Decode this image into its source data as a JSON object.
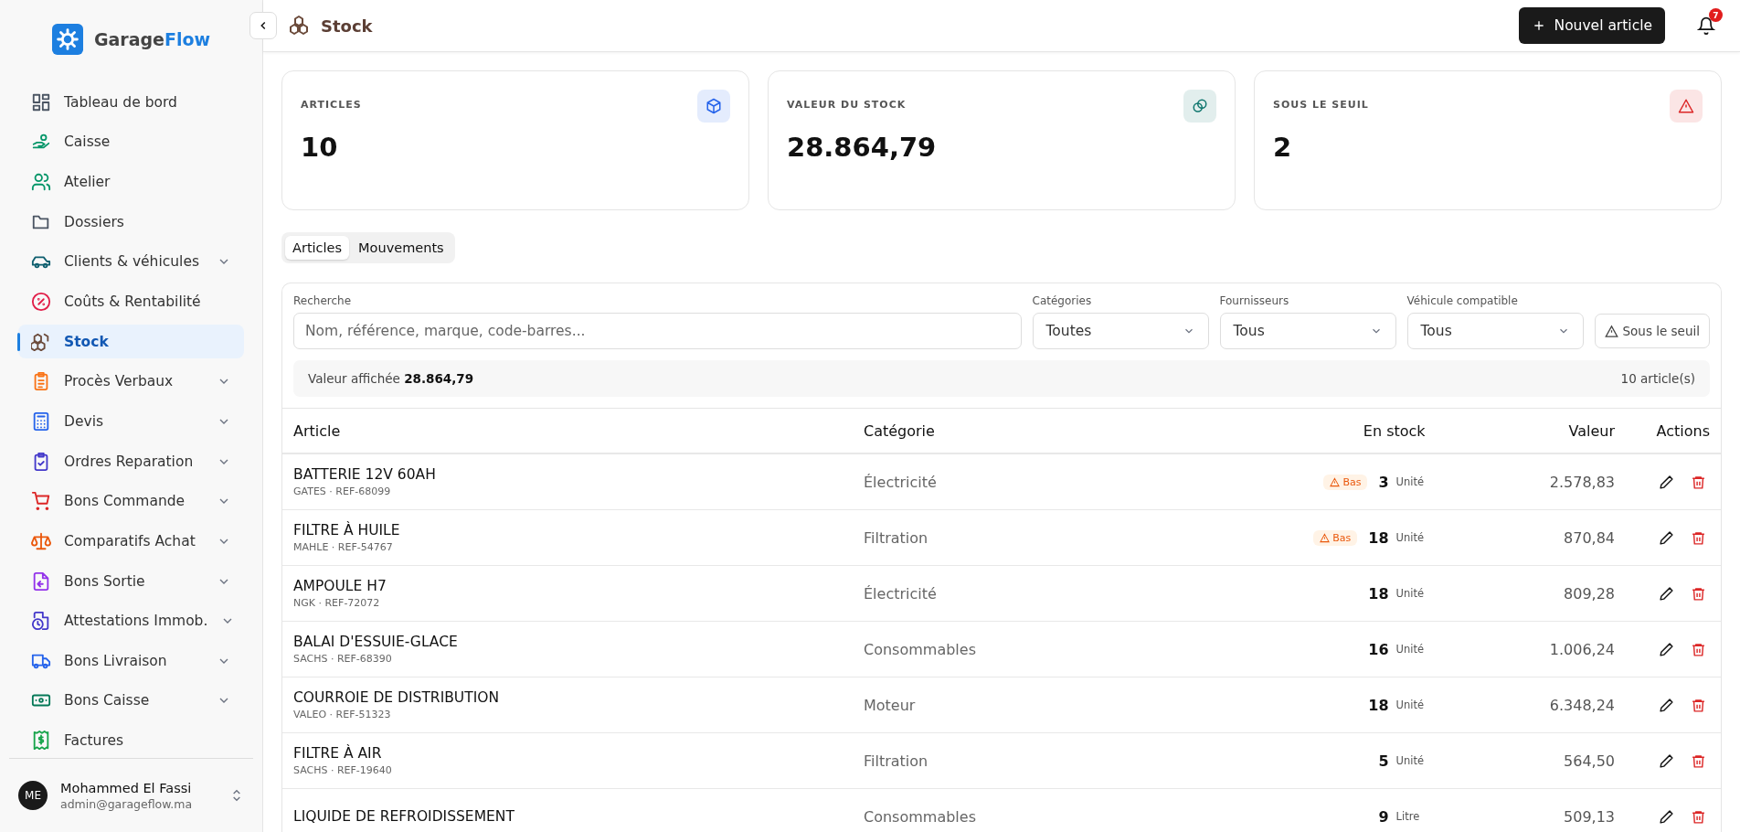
{
  "brand": {
    "name_first": "Garage",
    "name_second": "Flow"
  },
  "sidebar": {
    "items": [
      {
        "label": "Tableau de bord",
        "selected": false,
        "expandable": false,
        "color": "#4b5563"
      },
      {
        "label": "Caisse",
        "selected": false,
        "expandable": false,
        "color": "#059669"
      },
      {
        "label": "Atelier",
        "selected": false,
        "expandable": false,
        "color": "#059669"
      },
      {
        "label": "Dossiers",
        "selected": false,
        "expandable": false,
        "color": "#4b5563"
      },
      {
        "label": "Clients & véhicules",
        "selected": false,
        "expandable": true,
        "color": "#0f5f6f"
      },
      {
        "label": "Coûts & Rentabilité",
        "selected": false,
        "expandable": false,
        "color": "#e11d48"
      },
      {
        "label": "Stock",
        "selected": true,
        "expandable": false,
        "color": "#6b4a3a"
      },
      {
        "label": "Procès Verbaux",
        "selected": false,
        "expandable": true,
        "color": "#f97316"
      },
      {
        "label": "Devis",
        "selected": false,
        "expandable": true,
        "color": "#2563eb"
      },
      {
        "label": "Ordres Reparation",
        "selected": false,
        "expandable": true,
        "color": "#4338ca"
      },
      {
        "label": "Bons Commande",
        "selected": false,
        "expandable": true,
        "color": "#dc2626"
      },
      {
        "label": "Comparatifs Achat",
        "selected": false,
        "expandable": true,
        "color": "#ea580c"
      },
      {
        "label": "Bons Sortie",
        "selected": false,
        "expandable": true,
        "color": "#9333ea"
      },
      {
        "label": "Attestations Immob.",
        "selected": false,
        "expandable": true,
        "color": "#4338ca"
      },
      {
        "label": "Bons Livraison",
        "selected": false,
        "expandable": true,
        "color": "#2563eb"
      },
      {
        "label": "Bons Caisse",
        "selected": false,
        "expandable": true,
        "color": "#047857"
      },
      {
        "label": "Factures",
        "selected": false,
        "expandable": false,
        "color": "#16a34a"
      }
    ],
    "user": {
      "initials": "ME",
      "name": "Mohammed El Fassi",
      "email": "admin@garageflow.ma"
    }
  },
  "header": {
    "title": "Stock",
    "new_button": "Nouvel article",
    "notification_count": "7"
  },
  "stats": [
    {
      "label": "ARTICLES",
      "value": "10",
      "color": "#2563eb"
    },
    {
      "label": "VALEUR DU STOCK",
      "value": "28.864,79",
      "color": "#0f766e"
    },
    {
      "label": "SOUS LE SEUIL",
      "value": "2",
      "color": "#dc2626"
    }
  ],
  "tabs": [
    {
      "label": "Articles",
      "selected": true
    },
    {
      "label": "Mouvements",
      "selected": false
    }
  ],
  "filters": {
    "search": {
      "label": "Recherche",
      "placeholder": "Nom, référence, marque, code-barres..."
    },
    "selects": [
      {
        "label": "Catégories",
        "value": "Toutes"
      },
      {
        "label": "Fournisseurs",
        "value": "Tous"
      },
      {
        "label": "Véhicule compatible",
        "value": "Tous"
      }
    ],
    "threshold_button": "Sous le seuil"
  },
  "summary": {
    "label": "Valeur affichée",
    "value": "28.864,79",
    "count": "10 article(s)"
  },
  "table": {
    "columns": [
      "Article",
      "Catégorie",
      "En stock",
      "Valeur",
      "Actions"
    ],
    "rows": [
      {
        "name": "BATTERIE 12V 60AH",
        "sub": "GATES · REF-68099",
        "category": "Électricité",
        "badge": "Bas",
        "qty": "3",
        "unit": "Unité",
        "value": "2.578,83"
      },
      {
        "name": "FILTRE À HUILE",
        "sub": "MAHLE · REF-54767",
        "category": "Filtration",
        "badge": "Bas",
        "qty": "18",
        "unit": "Unité",
        "value": "870,84"
      },
      {
        "name": "AMPOULE H7",
        "sub": "NGK · REF-72072",
        "category": "Électricité",
        "qty": "18",
        "unit": "Unité",
        "value": "809,28"
      },
      {
        "name": "BALAI D'ESSUIE-GLACE",
        "sub": "SACHS · REF-68390",
        "category": "Consommables",
        "qty": "16",
        "unit": "Unité",
        "value": "1.006,24"
      },
      {
        "name": "COURROIE DE DISTRIBUTION",
        "sub": "VALEO · REF-51323",
        "category": "Moteur",
        "qty": "18",
        "unit": "Unité",
        "value": "6.348,24"
      },
      {
        "name": "FILTRE À AIR",
        "sub": "SACHS · REF-19640",
        "category": "Filtration",
        "qty": "5",
        "unit": "Unité",
        "value": "564,50"
      },
      {
        "name": "LIQUIDE DE REFROIDISSEMENT",
        "category": "Consommables",
        "qty": "9",
        "unit": "Litre",
        "value": "509,13"
      }
    ]
  }
}
